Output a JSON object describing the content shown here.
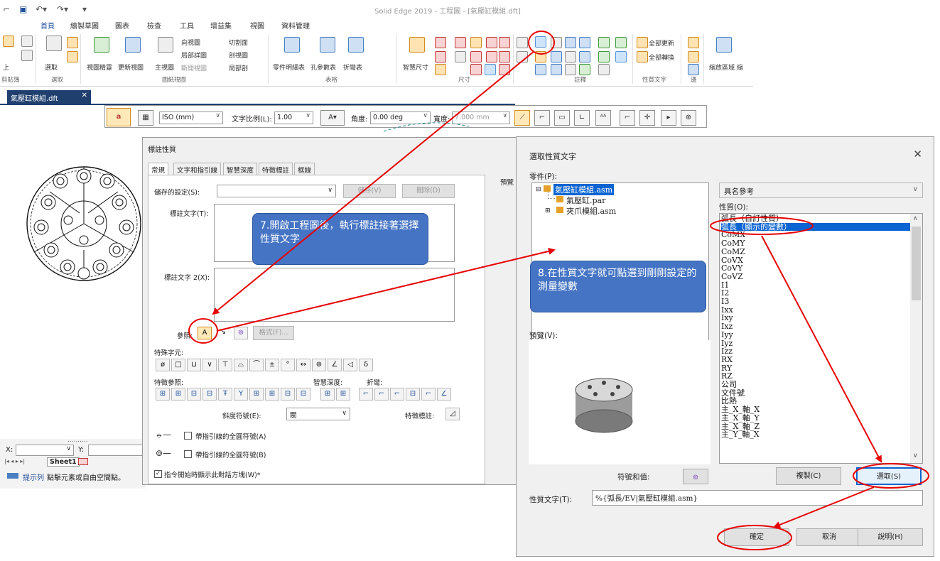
{
  "window": {
    "title": "Solid Edge 2019 - 工程圖 - [氣壓缸模組.dft]"
  },
  "tabs": [
    "首頁",
    "繪製草圖",
    "圖表",
    "檢查",
    "工具",
    "增益集",
    "視圖",
    "資料管理"
  ],
  "ribbon": {
    "clipboard": {
      "paste": "上",
      "group": "剪貼簿"
    },
    "select": {
      "label": "選取",
      "group": "選取"
    },
    "drawing_views": {
      "wizard": "視圖精靈",
      "update": "更新視圖",
      "principal": "主視圖",
      "projection": "向視圖",
      "detail": "局部詳圖",
      "broken": "斷開視圖",
      "section": "切割面",
      "section_view": "剖視圖",
      "broken_out": "局部剖",
      "group": "圖紙視圖"
    },
    "tables": {
      "parts_list": "零件明細表",
      "hole_table": "孔參數表",
      "bend_table": "折彎表",
      "group": "表格"
    },
    "dimension": {
      "smart": "智慧尺寸",
      "group": "尺寸"
    },
    "annotation": {
      "group": "註釋"
    },
    "property_text": {
      "update_all": "全部更新",
      "convert_all": "全部轉換",
      "group": "性質文字"
    },
    "edge": {
      "group": "邊"
    },
    "zoom_area": "縮放區域 縮"
  },
  "document_tab": {
    "name": "氣壓缸模組.dft",
    "close": "✕"
  },
  "command_bar": {
    "standard": "ISO (mm)",
    "text_scale_label": "文字比例(L):",
    "text_scale": "1.00",
    "angle_label": "角度:",
    "angle": "0.00 deg",
    "width_label": "寬度:",
    "width": "7.000 mm"
  },
  "callout_properties_dialog": {
    "title": "標註性質",
    "tabs": [
      "常規",
      "文字和指引線",
      "智慧深度",
      "特徵標註",
      "框線"
    ],
    "saved_settings_label": "儲存的設定(S):",
    "save_button": "儲存(V)",
    "delete_button": "刪除(D)",
    "callout_text_label": "標註文字(T):",
    "callout_text2_label": "標註文字 2(X):",
    "reference_label": "參照:",
    "format_button": "格式(F)...",
    "special_chars_label": "特殊字元:",
    "special_chars": [
      "ø",
      "□",
      "⊔",
      "∨",
      "⊤",
      "⌓",
      "⌒",
      "±",
      "°",
      "↔",
      "⊚",
      "∠",
      "◁",
      "δ"
    ],
    "feature_ref_label": "特徵參照:",
    "smart_depth_label": "智慧深度:",
    "bend_label": "折彎:",
    "chamfer_label": "斜度符號(E):",
    "chamfer_value": "關",
    "feature_callout_label": "特徵標註:",
    "all_around_a": "帶指引線的全圓符號(A)",
    "all_around_b": "帶指引線的全圓符號(B)",
    "show_dialog": "指令開始時顯示此對話方塊(W)*",
    "preview_label": "預覽"
  },
  "select_property_dialog": {
    "title": "選取性質文字",
    "parts_label": "零件(P):",
    "tree": [
      "氣壓缸模組.asm",
      "氣壓缸.par",
      "夾爪模組.asm"
    ],
    "preview_label": "預覽(V):",
    "named_ref": "具名參考",
    "properties_label": "性質(O):",
    "properties": [
      "弧長（自訂性質）",
      "弧長（顯示的變數）",
      "CoMX",
      "CoMY",
      "CoMZ",
      "CoVX",
      "CoVY",
      "CoVZ",
      "I1",
      "I2",
      "I3",
      "Ixx",
      "Ixy",
      "Ixz",
      "Iyy",
      "Iyz",
      "Izz",
      "RX",
      "RY",
      "RZ",
      "公司",
      "文件號",
      "比熱",
      "主_X_軸_X",
      "主_X_軸_Y",
      "主_X_軸_Z",
      "主_Y_軸_X"
    ],
    "selected_index": 1,
    "symbol_value_label": "符號和值:",
    "copy_button": "複製(C)",
    "select_button": "選取(S)",
    "property_text_label": "性質文字(T):",
    "property_text_value": "%{弧長/EV|氣壓缸模組.asm}",
    "ok_button": "確定",
    "cancel_button": "取消",
    "help_button": "說明(H)"
  },
  "callouts": {
    "step7": "7.開啟工程圖後，執行標註接著選擇性質文字",
    "step8": "8.在性質文字就可點選到剛剛設定的測量變數"
  },
  "status": {
    "x_label": "X:",
    "y_label": "Y:",
    "sheet": "Sheet1",
    "prompt_label": "提示列",
    "prompt": "點擊元素或自由空間點。"
  }
}
